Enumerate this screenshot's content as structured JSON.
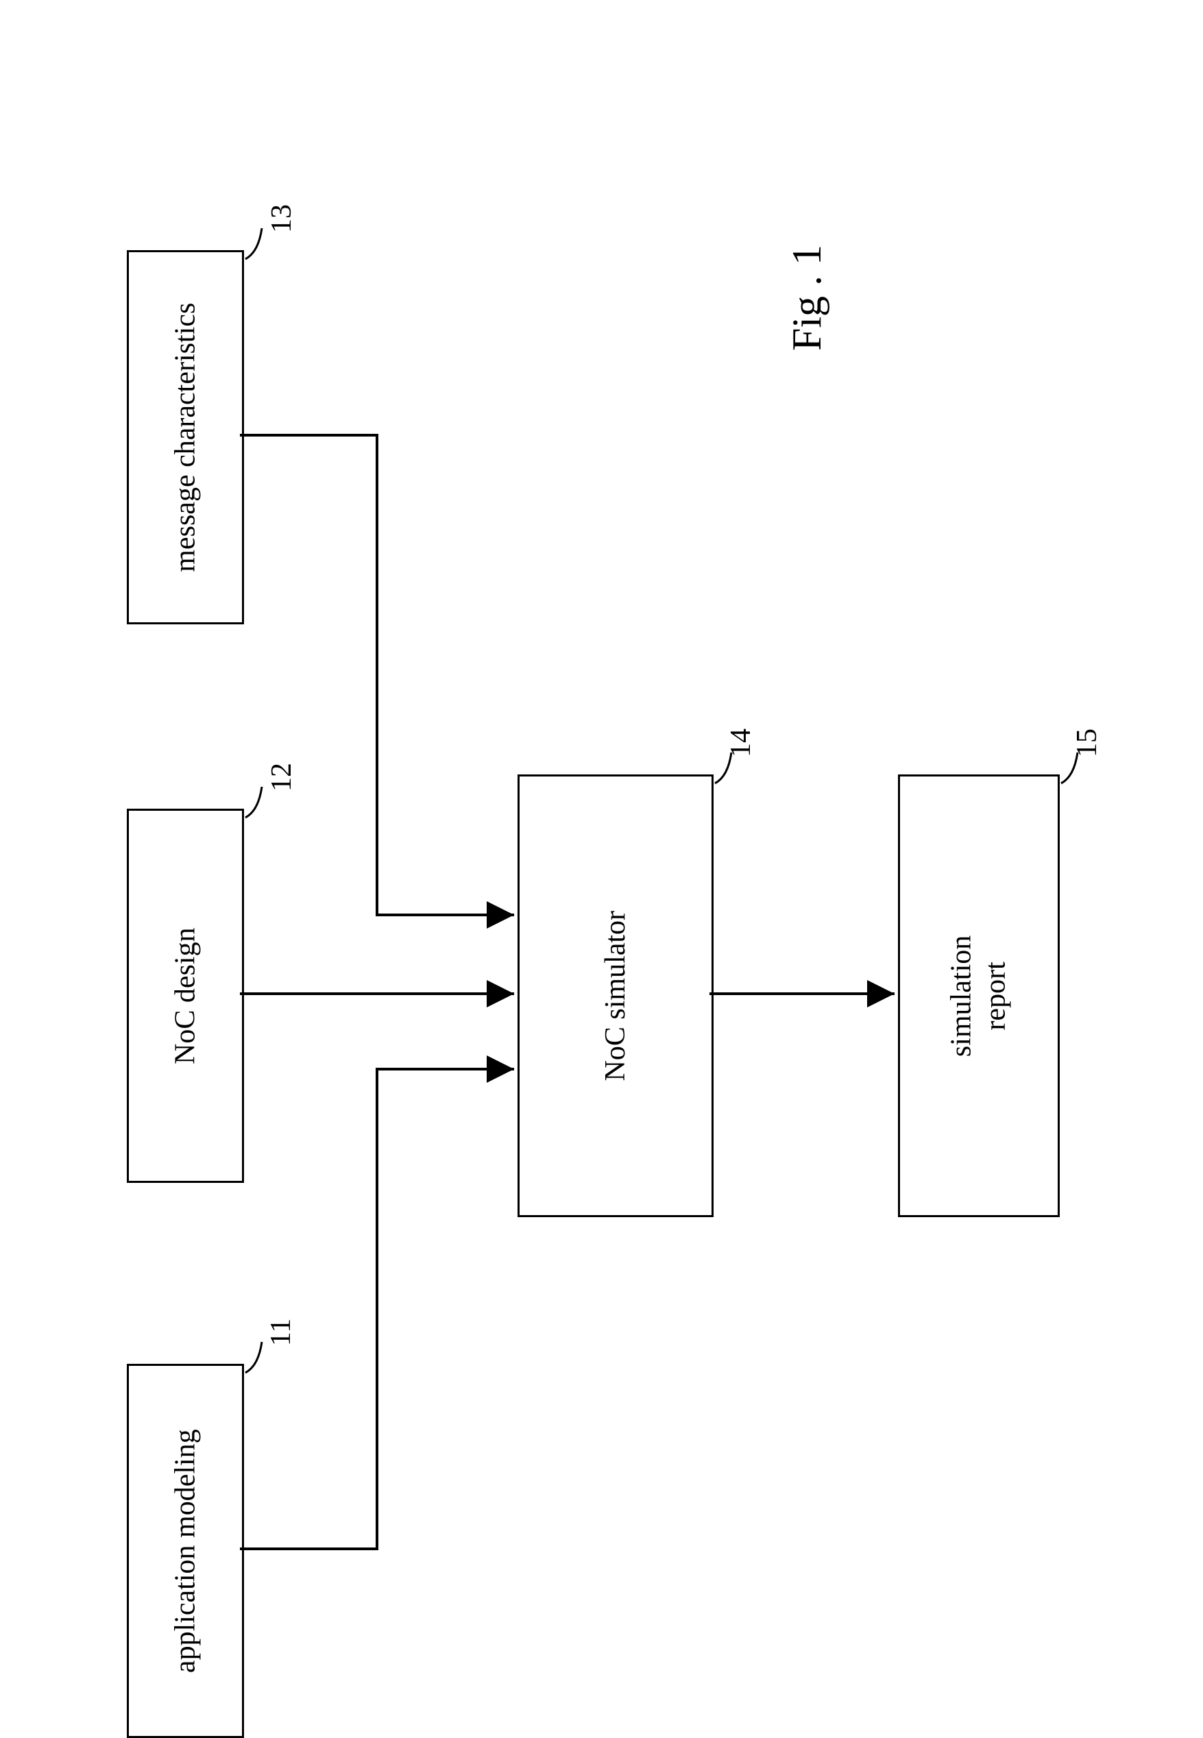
{
  "blocks": {
    "app_modeling": {
      "label": "application modeling",
      "ref": "11"
    },
    "noc_design": {
      "label": "NoC design",
      "ref": "12"
    },
    "msg_char": {
      "label": "message characteristics",
      "ref": "13"
    },
    "simulator": {
      "label": "NoC simulator",
      "ref": "14"
    },
    "report": {
      "label": "simulation\nreport",
      "ref": "15"
    }
  },
  "caption": "Fig . 1"
}
